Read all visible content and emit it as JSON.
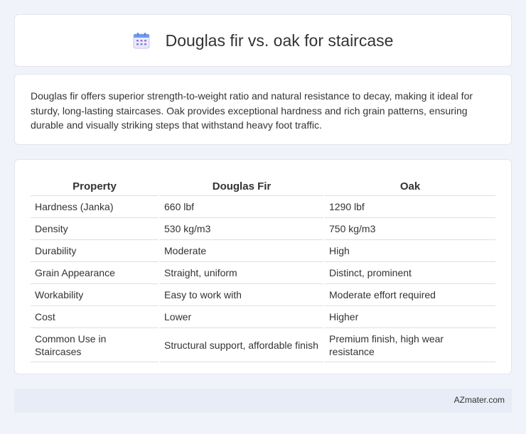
{
  "header": {
    "title": "Douglas fir vs. oak for staircase",
    "icon": "calendar-icon"
  },
  "description": "Douglas fir offers superior strength-to-weight ratio and natural resistance to decay, making it ideal for sturdy, long-lasting staircases. Oak provides exceptional hardness and rich grain patterns, ensuring durable and visually striking steps that withstand heavy foot traffic.",
  "table": {
    "headers": [
      "Property",
      "Douglas Fir",
      "Oak"
    ],
    "rows": [
      [
        "Hardness (Janka)",
        "660 lbf",
        "1290 lbf"
      ],
      [
        "Density",
        "530 kg/m3",
        "750 kg/m3"
      ],
      [
        "Durability",
        "Moderate",
        "High"
      ],
      [
        "Grain Appearance",
        "Straight, uniform",
        "Distinct, prominent"
      ],
      [
        "Workability",
        "Easy to work with",
        "Moderate effort required"
      ],
      [
        "Cost",
        "Lower",
        "Higher"
      ],
      [
        "Common Use in Staircases",
        "Structural support, affordable finish",
        "Premium finish, high wear resistance"
      ]
    ]
  },
  "footer": {
    "brand": "AZmater.com"
  },
  "colors": {
    "background": "#f0f3f9",
    "icon_accent": "#8a7ee0",
    "icon_header": "#5b8de8"
  }
}
